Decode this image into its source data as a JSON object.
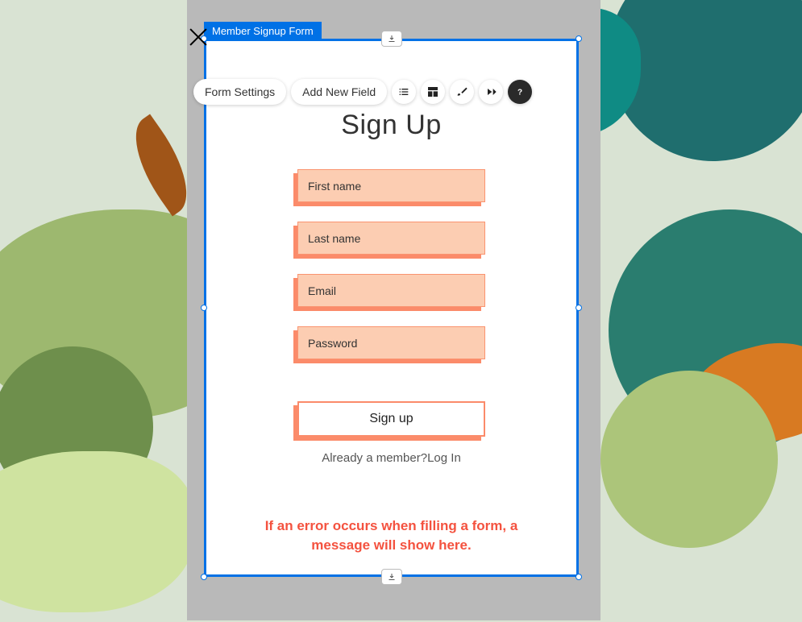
{
  "selection": {
    "label": "Member Signup Form"
  },
  "toolbar": {
    "settings_label": "Form Settings",
    "add_field_label": "Add New Field"
  },
  "form": {
    "title": "Sign Up",
    "fields": {
      "first_name": {
        "placeholder": "First name",
        "value": ""
      },
      "last_name": {
        "placeholder": "Last name",
        "value": ""
      },
      "email": {
        "placeholder": "Email",
        "value": ""
      },
      "password": {
        "placeholder": "Password",
        "value": ""
      }
    },
    "submit_label": "Sign up",
    "already_text": "Already a member?",
    "login_link": "Log In",
    "error_text": "If an error occurs when filling a form, a message will show here."
  }
}
